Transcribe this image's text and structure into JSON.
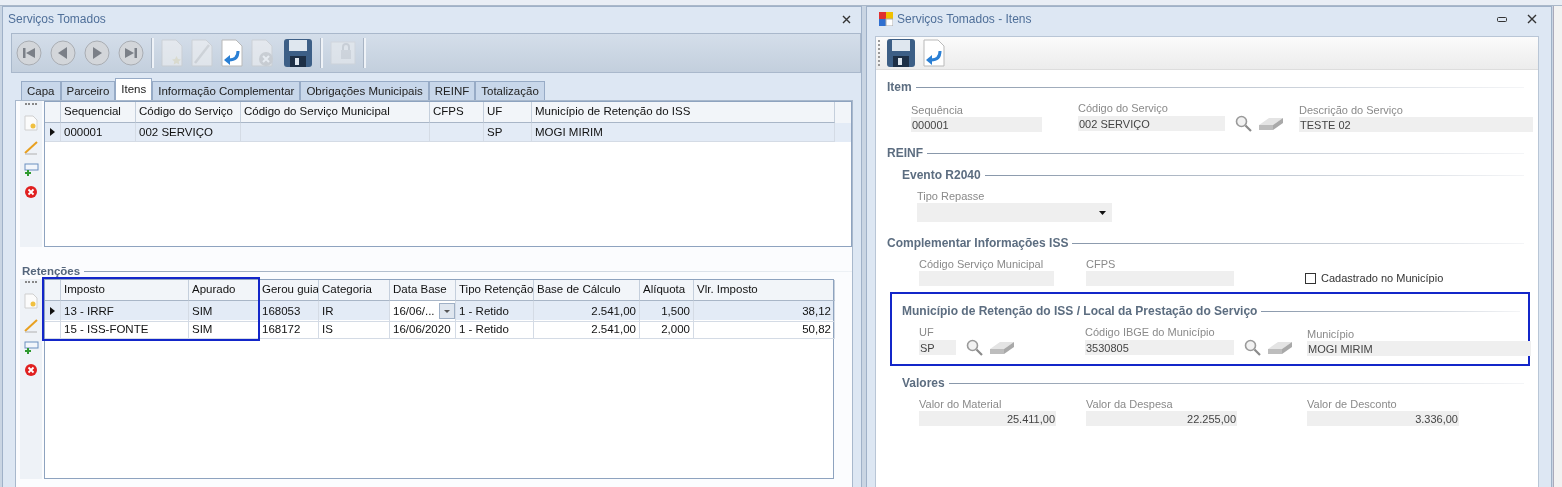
{
  "left_window": {
    "title": "Serviços Tomados",
    "toolbar": [
      {
        "kind": "first",
        "disabled": false
      },
      {
        "kind": "previous",
        "disabled": false
      },
      {
        "kind": "next",
        "disabled": false
      },
      {
        "kind": "last",
        "disabled": false
      },
      {
        "kind": "separator"
      },
      {
        "kind": "new",
        "disabled": true
      },
      {
        "kind": "edit",
        "disabled": true
      },
      {
        "kind": "undo",
        "disabled": false
      },
      {
        "kind": "delete",
        "disabled": true
      },
      {
        "kind": "save",
        "disabled": false
      },
      {
        "kind": "separator"
      },
      {
        "kind": "lock",
        "disabled": true
      },
      {
        "kind": "separator"
      }
    ],
    "tabs": [
      {
        "label": "Capa",
        "selected": false
      },
      {
        "label": "Parceiro",
        "selected": false
      },
      {
        "label": "Itens",
        "selected": true
      },
      {
        "label": "Informação Complementar",
        "selected": false
      },
      {
        "label": "Obrigações Municipais",
        "selected": false
      },
      {
        "label": "REINF",
        "selected": false
      },
      {
        "label": "Totalização",
        "selected": false
      }
    ],
    "items_grid": {
      "columns": [
        {
          "label": "Sequencial"
        },
        {
          "label": "Código do Serviço"
        },
        {
          "label": "Código do Serviço Municipal"
        },
        {
          "label": "CFPS"
        },
        {
          "label": "UF"
        },
        {
          "label": "Município de Retenção do ISS"
        }
      ],
      "rows": [
        {
          "current": true,
          "cells": [
            "000001",
            "002 SERVIÇO",
            "",
            "",
            "SP",
            "MOGI MIRIM"
          ]
        }
      ]
    },
    "retencoes": {
      "title": "Retenções",
      "columns": [
        {
          "label": "Imposto",
          "highlighted": true
        },
        {
          "label": "Apurado",
          "highlighted": true
        },
        {
          "label": "Gerou guia"
        },
        {
          "label": "Categoria"
        },
        {
          "label": "Data Base",
          "kind": "dropdown"
        },
        {
          "label": "Tipo Retenção"
        },
        {
          "label": "Base de Cálculo",
          "kind": "number"
        },
        {
          "label": "Alíquota",
          "kind": "number"
        },
        {
          "label": "Vlr. Imposto",
          "kind": "number"
        }
      ],
      "rows": [
        {
          "current": true,
          "cells": [
            "13 - IRRF",
            "SIM",
            "168053",
            "IR",
            "16/06/...",
            "1 - Retido",
            "2.541,00",
            "1,500",
            "38,12"
          ]
        },
        {
          "current": false,
          "cells": [
            "15 - ISS-FONTE",
            "SIM",
            "168172",
            "IS",
            "16/06/2020",
            "1 - Retido",
            "2.541,00",
            "2,000",
            "50,82"
          ]
        }
      ]
    }
  },
  "right_window": {
    "title": "Serviços Tomados - Itens",
    "toolbar": [
      {
        "kind": "save",
        "disabled": false
      },
      {
        "kind": "undo",
        "disabled": false
      }
    ],
    "sections": [
      {
        "title": "Item",
        "fields": [
          {
            "label": "Sequência",
            "value": "000001",
            "kind": "text"
          },
          {
            "label": "Código do Serviço",
            "value": "002 SERVIÇO",
            "kind": "lookup"
          },
          {
            "label": "Descrição do Serviço",
            "value": "TESTE 02",
            "kind": "text"
          }
        ]
      },
      {
        "title": "REINF",
        "children": [
          {
            "title": "Evento R2040",
            "fields": [
              {
                "label": "Tipo Repasse",
                "kind": "dropdown"
              }
            ]
          }
        ]
      },
      {
        "title": "Complementar Informações ISS",
        "fields": [
          {
            "label": "Código Serviço Municipal",
            "kind": "text"
          },
          {
            "label": "CFPS",
            "kind": "text"
          },
          {
            "label": "Cadastrado no Município",
            "kind": "checkbox",
            "checked": false
          }
        ],
        "children": [
          {
            "title": "Município de Retenção do ISS / Local da Prestação  do Serviço",
            "highlighted": true,
            "fields": [
              {
                "label": "UF",
                "value": "SP",
                "kind": "lookup"
              },
              {
                "label": "Código IBGE do Município",
                "value": "3530805",
                "kind": "lookup"
              },
              {
                "label": "Município",
                "value": "MOGI MIRIM",
                "kind": "text"
              }
            ]
          },
          {
            "title": "Valores",
            "fields": [
              {
                "label": "Valor do Material",
                "value": "25.411,00",
                "kind": "amount"
              },
              {
                "label": "Valor da Despesa",
                "value": "22.255,00",
                "kind": "amount"
              },
              {
                "label": "Valor de Desconto",
                "value": "3.336,00",
                "kind": "amount"
              }
            ]
          }
        ]
      }
    ]
  }
}
